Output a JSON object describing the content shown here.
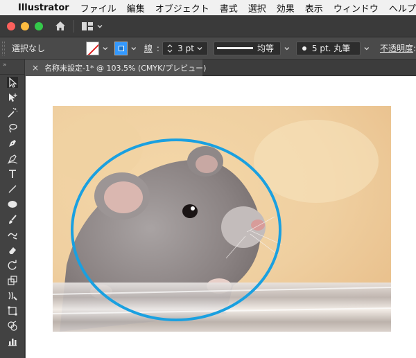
{
  "menubar": {
    "app_name": "Illustrator",
    "items": [
      "ファイル",
      "編集",
      "オブジェクト",
      "書式",
      "選択",
      "効果",
      "表示",
      "ウィンドウ",
      "ヘルプ"
    ]
  },
  "control_bar": {
    "selection_label": "選択なし",
    "stroke_label": "線",
    "stroke_weight": "3 pt",
    "profile_label": "均等",
    "brush_label": "5 pt. 丸筆",
    "opacity_label": "不透明度"
  },
  "toolbar": {
    "collapse_glyph": "»",
    "tools": [
      "selection-tool-icon",
      "direct-selection-tool-icon",
      "magic-wand-tool-icon",
      "lasso-tool-icon",
      "pen-tool-icon",
      "curvature-tool-icon",
      "type-tool-icon",
      "line-tool-icon",
      "ellipse-tool-icon",
      "paintbrush-tool-icon",
      "shaper-tool-icon",
      "eraser-tool-icon",
      "rotate-tool-icon",
      "scale-tool-icon",
      "warp-tool-icon",
      "free-transform-tool-icon",
      "shape-builder-tool-icon",
      "graph-tool-icon"
    ]
  },
  "document": {
    "close_glyph": "×",
    "tab_title": "名称未設定-1* @ 103.5% (CMYK/プレビュー)"
  },
  "colors": {
    "ellipse_stroke": "#1aa0e0",
    "canvas": "#ffffff",
    "ui_dark": "#535353"
  }
}
